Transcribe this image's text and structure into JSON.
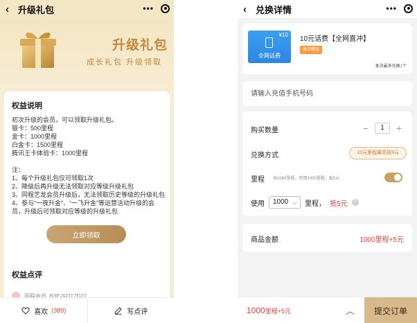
{
  "left": {
    "nav": {
      "back": "‹",
      "title": "升级礼包",
      "menu": "•••"
    },
    "banner": {
      "title": "升级礼包",
      "subtitle": "成长礼包  升级领取"
    },
    "benefits": {
      "title": "权益说明",
      "lines": [
        "初次升级的会员，可以领取升级礼包。",
        "银卡：500里程",
        "金卡：1000里程",
        "白金卡：1500里程",
        "腾讯王卡体验卡：1000里程"
      ],
      "notes_title": "注：",
      "notes": [
        "1、每个升级礼包仅可领取1次",
        "2、降级后再升级无法领取对应等级升级礼包",
        "3、同程艺龙会员升级后，无法领取历史等级的升级礼包",
        "4、参与“一夜升金”、“一飞升金”等运营活动升级的会员，升级后可领取对应等级的升级礼包"
      ]
    },
    "claim_button": "立即领取",
    "reviews": {
      "title": "权益点评",
      "reviewer": "同程会员_B3E2FD17D22"
    },
    "bottom": {
      "like_label": "喜欢",
      "like_count": "(389)",
      "review_label": "写点评"
    }
  },
  "right": {
    "nav": {
      "back": "‹",
      "title": "兑换详情",
      "menu": "•••"
    },
    "product": {
      "voucher_amount": "¥10",
      "voucher_label": "全网话费",
      "name": "10元话费【全网直冲】",
      "badge": "每日精选",
      "limit_prefix": "本次最多兑换",
      "limit_count": "1",
      "limit_suffix": "个"
    },
    "phone_placeholder": "请输入充值手机号码",
    "options": {
      "quantity_label": "购买数量",
      "quantity_minus": "−",
      "quantity": "1",
      "quantity_plus": "+",
      "method_label": "兑换方式",
      "method_value": "10元里程最高抵9元",
      "miles_label": "里程",
      "miles_hint": "共1080里程，可用1000里程，抵5元",
      "use_label": "使用",
      "use_value": "1000",
      "use_unit": "里程，",
      "deduct": "抵5元",
      "help": "?"
    },
    "amount": {
      "label": "商品金额",
      "value": "1000里程+5元"
    },
    "bottom": {
      "total_main": "1000",
      "total_rest": "里程+5元",
      "caret": "︿",
      "submit": "提交订单"
    }
  },
  "colors": {
    "gold": "#c8883c",
    "red": "#e0413b",
    "blue": "#2d86e3",
    "submit_bg": "#d7b98c"
  }
}
